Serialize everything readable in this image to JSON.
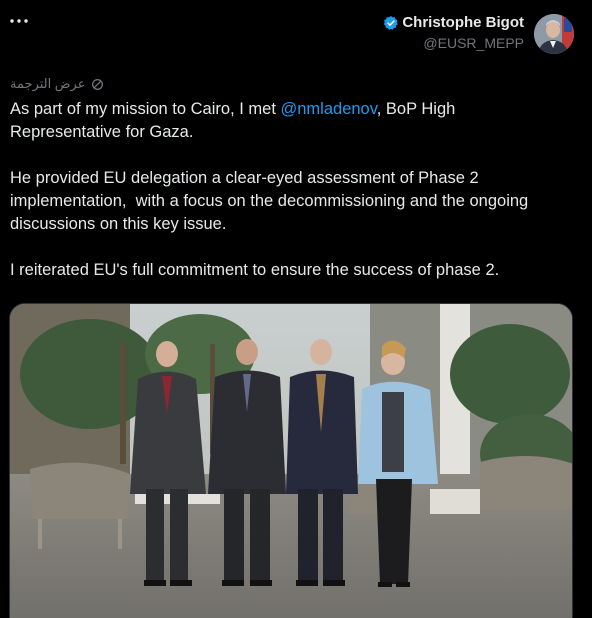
{
  "more_icon": "more-horizontal-icon",
  "author": {
    "name": "Christophe Bigot",
    "handle": "@EUSR_MEPP",
    "verified_icon": "verified-badge-icon",
    "verified_color": "#1d9bf0"
  },
  "translate": {
    "label": "عرض الترجمة",
    "icon": "translate-icon"
  },
  "tweet": {
    "line1_before": "As part of my mission to Cairo, I met ",
    "mention": "@nmladenov",
    "line1_after": ", BoP High Representative for Gaza.",
    "paragraph2": "He provided EU delegation a clear-eyed assessment of Phase 2 implementation,  with a focus on the decommissioning and the ongoing discussions on this key issue.",
    "paragraph3": "I reiterated EU's full commitment to ensure the success of phase 2."
  },
  "colors": {
    "background": "#000000",
    "text": "#e7e9ea",
    "secondary": "#71767b",
    "accent": "#1d9bf0"
  }
}
